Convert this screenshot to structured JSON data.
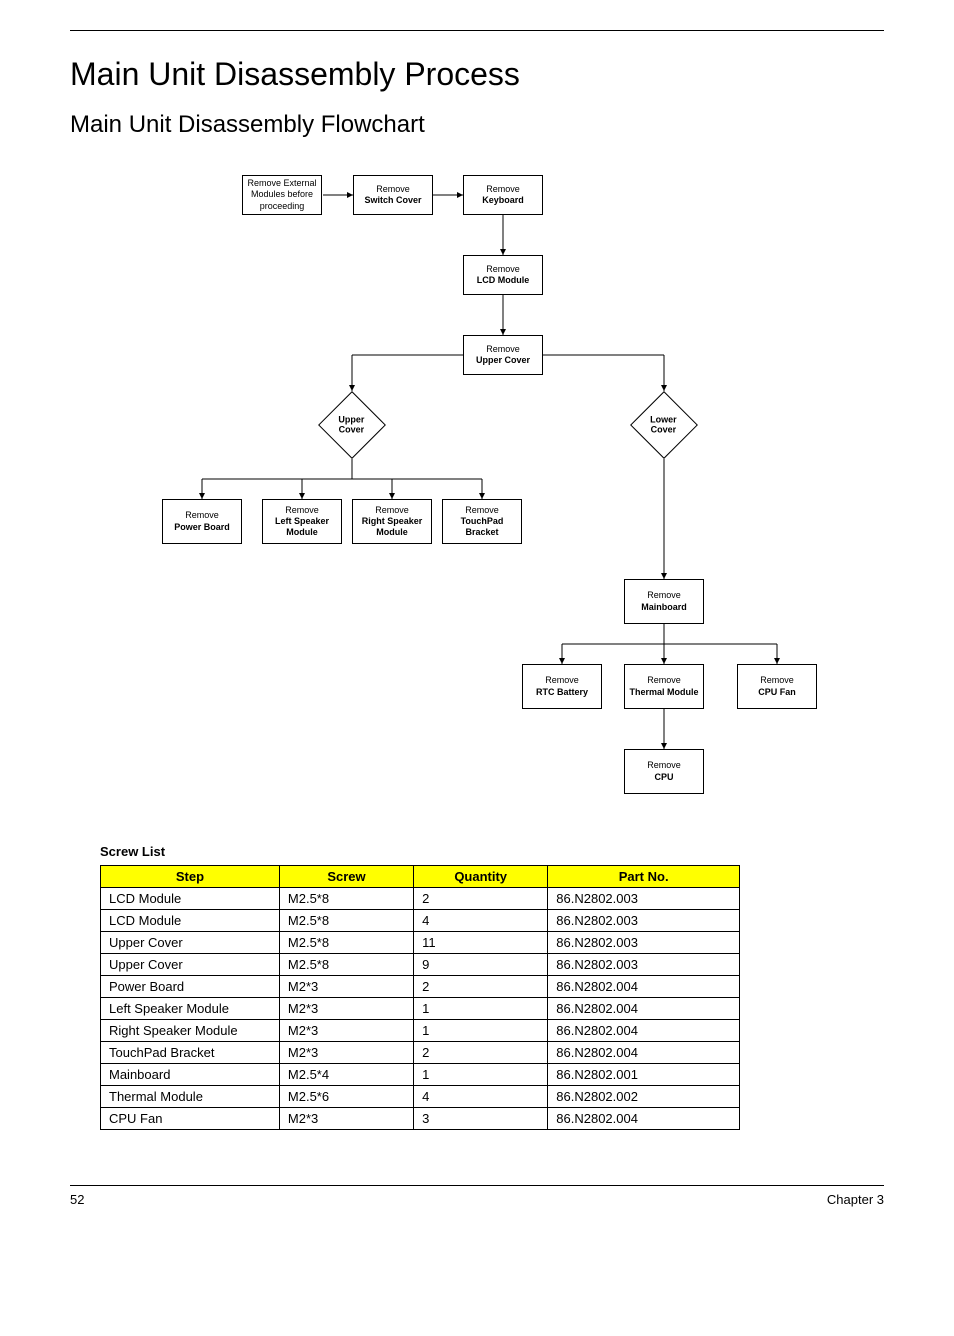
{
  "title": "Main Unit Disassembly Process",
  "subtitle": "Main Unit Disassembly Flowchart",
  "flow": {
    "start": {
      "l1": "Remove External",
      "l2": "Modules before",
      "l3": "proceeding"
    },
    "switch_cover": {
      "l1": "Remove",
      "l2": "Switch Cover"
    },
    "keyboard": {
      "l1": "Remove",
      "l2": "Keyboard"
    },
    "lcd": {
      "l1": "Remove",
      "l2": "LCD Module"
    },
    "upper_cover_remove": {
      "l1": "Remove",
      "l2": "Upper Cover"
    },
    "upper_diamond": {
      "l1": "Upper",
      "l2": "Cover"
    },
    "lower_diamond": {
      "l1": "Lower",
      "l2": "Cover"
    },
    "power_board": {
      "l1": "Remove",
      "l2": "Power Board"
    },
    "left_speaker": {
      "l1": "Remove",
      "l2": "Left Speaker",
      "l3": "Module"
    },
    "right_speaker": {
      "l1": "Remove",
      "l2": "Right Speaker",
      "l3": "Module"
    },
    "touchpad": {
      "l1": "Remove",
      "l2": "TouchPad",
      "l3": "Bracket"
    },
    "mainboard": {
      "l1": "Remove",
      "l2": "Mainboard"
    },
    "rtc": {
      "l1": "Remove",
      "l2": "RTC Battery"
    },
    "thermal": {
      "l1": "Remove",
      "l2": "Thermal Module"
    },
    "cpu_fan": {
      "l1": "Remove",
      "l2": "CPU Fan"
    },
    "cpu": {
      "l1": "Remove",
      "l2": "CPU"
    }
  },
  "screw_table": {
    "title": "Screw List",
    "headers": {
      "step": "Step",
      "screw": "Screw",
      "qty": "Quantity",
      "part": "Part No."
    },
    "rows": [
      {
        "step": "LCD Module",
        "screw": "M2.5*8",
        "qty": "2",
        "part": "86.N2802.003"
      },
      {
        "step": "LCD Module",
        "screw": "M2.5*8",
        "qty": "4",
        "part": "86.N2802.003"
      },
      {
        "step": "Upper Cover",
        "screw": "M2.5*8",
        "qty": "11",
        "part": "86.N2802.003"
      },
      {
        "step": "Upper Cover",
        "screw": "M2.5*8",
        "qty": "9",
        "part": "86.N2802.003"
      },
      {
        "step": "Power Board",
        "screw": "M2*3",
        "qty": "2",
        "part": "86.N2802.004"
      },
      {
        "step": "Left Speaker Module",
        "screw": "M2*3",
        "qty": "1",
        "part": "86.N2802.004"
      },
      {
        "step": "Right Speaker Module",
        "screw": "M2*3",
        "qty": "1",
        "part": "86.N2802.004"
      },
      {
        "step": "TouchPad Bracket",
        "screw": "M2*3",
        "qty": "2",
        "part": "86.N2802.004"
      },
      {
        "step": "Mainboard",
        "screw": "M2.5*4",
        "qty": "1",
        "part": "86.N2802.001"
      },
      {
        "step": "Thermal Module",
        "screw": "M2.5*6",
        "qty": "4",
        "part": "86.N2802.002"
      },
      {
        "step": "CPU Fan",
        "screw": "M2*3",
        "qty": "3",
        "part": "86.N2802.004"
      }
    ]
  },
  "footer": {
    "page": "52",
    "chapter": "Chapter 3"
  }
}
